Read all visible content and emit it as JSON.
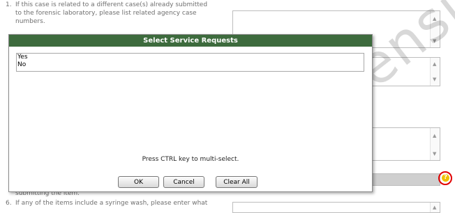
{
  "questions": [
    {
      "number": "1.",
      "lines": [
        "If this case is related to a different case(s) already submitted",
        "to the forensic laboratory, please list related agency case",
        "numbers."
      ]
    },
    {
      "number": "",
      "lines": [
        "submitting the item."
      ]
    },
    {
      "number": "6.",
      "lines": [
        "If any of the items include a syringe wash, please enter what"
      ]
    }
  ],
  "watermark": "Forensic Servic",
  "dialog": {
    "title": "Select Service Requests",
    "options": [
      "Yes",
      "No"
    ],
    "hint": "Press CTRL key to multi-select.",
    "ok": "OK",
    "cancel": "Cancel",
    "clear_all": "Clear All"
  },
  "icons": {
    "help": "help-icon",
    "scroll_up": "scroll-up-icon",
    "scroll_down": "scroll-down-icon"
  },
  "colors": {
    "title_bar": "#3d6b3d",
    "help_ring": "#e10000"
  }
}
